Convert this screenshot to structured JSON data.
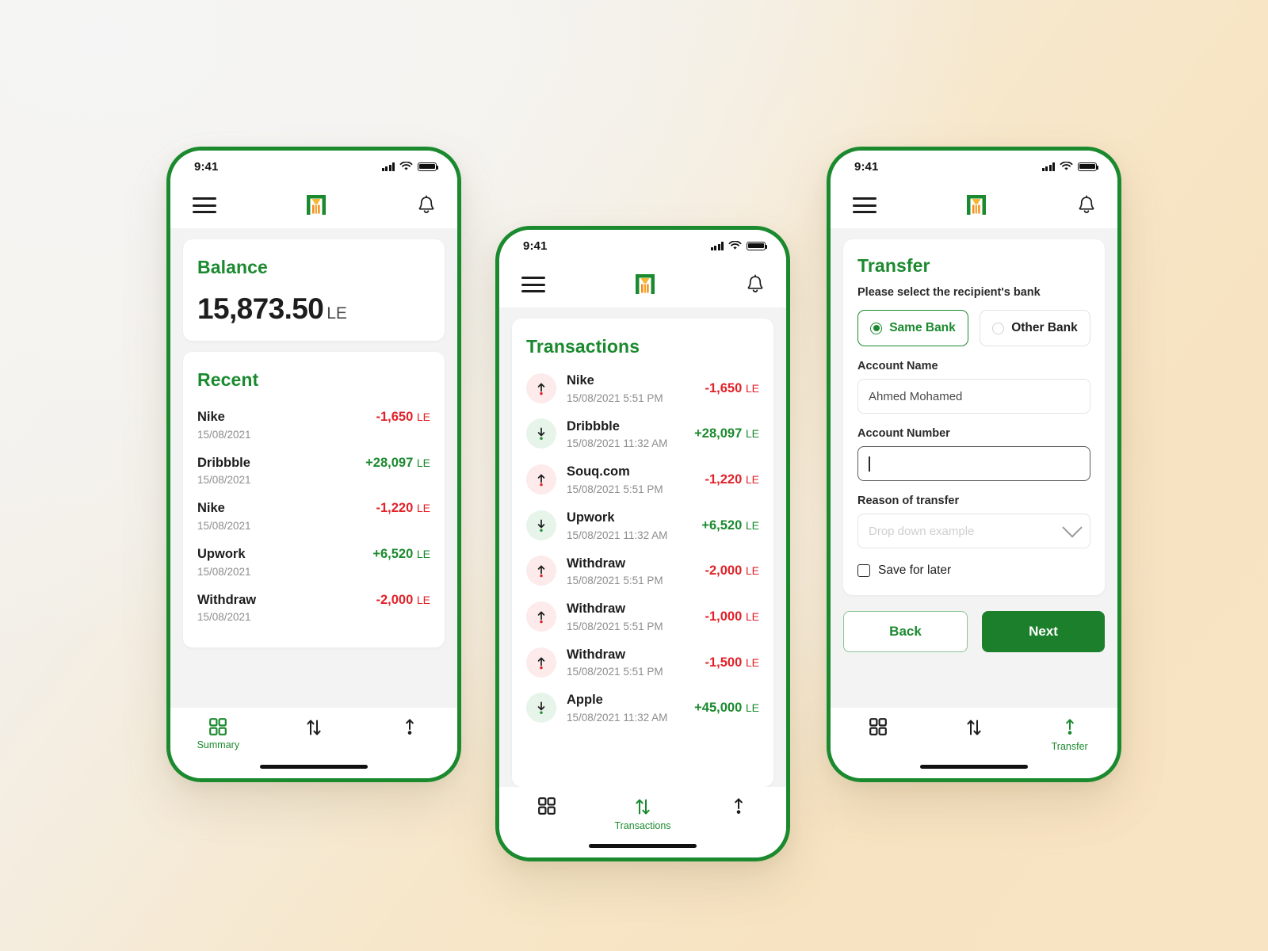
{
  "theme": {
    "green": "#1B8A2F",
    "green_dark": "#1B7F2B",
    "red": "#e12229",
    "orange": "#F5A623",
    "bg_light": "#f4f4f4",
    "bg_cream": "#f8e4c3"
  },
  "status_bar": {
    "time": "9:41"
  },
  "app_bar": {
    "menu_icon": "hamburger-menu-icon",
    "logo_icon": "bank-logo-icon",
    "bell_icon": "notification-bell-icon"
  },
  "nav": {
    "items": [
      {
        "label": "Summary",
        "icon": "grid-icon"
      },
      {
        "label": "Transactions",
        "icon": "transfer-arrows-icon"
      },
      {
        "label": "Transfer",
        "icon": "send-up-icon"
      }
    ]
  },
  "screen_summary": {
    "nav_active": 0,
    "balance": {
      "title": "Balance",
      "amount": "15,873.50",
      "currency": "LE"
    },
    "recent": {
      "title": "Recent",
      "rows": [
        {
          "name": "Nike",
          "date": "15/08/2021",
          "amount": "-1,650",
          "currency": "LE",
          "dir": "out"
        },
        {
          "name": "Dribbble",
          "date": "15/08/2021",
          "amount": "+28,097",
          "currency": "LE",
          "dir": "in"
        },
        {
          "name": "Nike",
          "date": "15/08/2021",
          "amount": "-1,220",
          "currency": "LE",
          "dir": "out"
        },
        {
          "name": "Upwork",
          "date": "15/08/2021",
          "amount": "+6,520",
          "currency": "LE",
          "dir": "in"
        },
        {
          "name": "Withdraw",
          "date": "15/08/2021",
          "amount": "-2,000",
          "currency": "LE",
          "dir": "out"
        }
      ]
    }
  },
  "screen_transactions": {
    "nav_active": 1,
    "title": "Transactions",
    "rows": [
      {
        "name": "Nike",
        "date": "15/08/2021 5:51 PM",
        "amount": "-1,650",
        "currency": "LE",
        "dir": "out"
      },
      {
        "name": "Dribbble",
        "date": "15/08/2021 11:32 AM",
        "amount": "+28,097",
        "currency": "LE",
        "dir": "in"
      },
      {
        "name": "Souq.com",
        "date": "15/08/2021 5:51 PM",
        "amount": "-1,220",
        "currency": "LE",
        "dir": "out"
      },
      {
        "name": "Upwork",
        "date": "15/08/2021 11:32 AM",
        "amount": "+6,520",
        "currency": "LE",
        "dir": "in"
      },
      {
        "name": "Withdraw",
        "date": "15/08/2021 5:51 PM",
        "amount": "-2,000",
        "currency": "LE",
        "dir": "out"
      },
      {
        "name": "Withdraw",
        "date": "15/08/2021 5:51 PM",
        "amount": "-1,000",
        "currency": "LE",
        "dir": "out"
      },
      {
        "name": "Withdraw",
        "date": "15/08/2021 5:51 PM",
        "amount": "-1,500",
        "currency": "LE",
        "dir": "out"
      },
      {
        "name": "Apple",
        "date": "15/08/2021 11:32 AM",
        "amount": "+45,000",
        "currency": "LE",
        "dir": "in"
      }
    ]
  },
  "screen_transfer": {
    "nav_active": 2,
    "title": "Transfer",
    "subtitle": "Please select the recipient's bank",
    "bank_options": [
      {
        "label": "Same Bank",
        "selected": true
      },
      {
        "label": "Other Bank",
        "selected": false
      }
    ],
    "account_name": {
      "label": "Account Name",
      "value": "Ahmed Mohamed"
    },
    "account_number": {
      "label": "Account Number",
      "value": "",
      "focused": true
    },
    "reason": {
      "label": "Reason of transfer",
      "placeholder": "Drop down example",
      "value": ""
    },
    "save_for_later": {
      "label": "Save for later",
      "checked": false
    },
    "buttons": {
      "back": "Back",
      "next": "Next"
    }
  }
}
